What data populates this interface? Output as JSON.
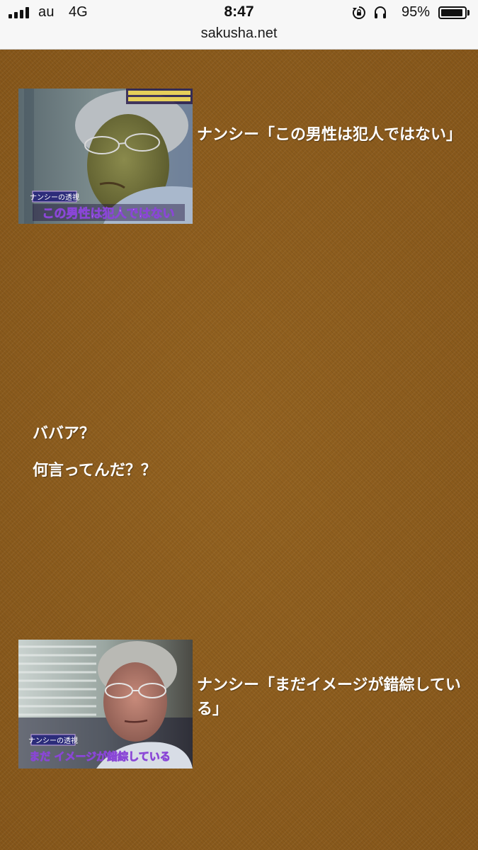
{
  "status_bar": {
    "carrier": "au",
    "network": "4G",
    "time": "8:47",
    "battery_percent": "95%",
    "battery_level": 0.95,
    "icons": [
      "signal-icon",
      "rotation-lock-icon",
      "headphone-icon",
      "battery-icon"
    ]
  },
  "browser": {
    "url": "sakusha.net"
  },
  "article": {
    "items": [
      {
        "image_subtitle": "この男性は犯人ではない",
        "image_label": "ナンシーの透視",
        "caption": "ナンシー「この男性は犯人ではない」"
      },
      {
        "image_subtitle": "まだ イメージが錯綜している",
        "image_label": "ナンシーの透視",
        "caption": "ナンシー「まだイメージが錯綜している」"
      }
    ],
    "remarks": [
      "ババア？",
      "何言ってんだ？？"
    ]
  },
  "colors": {
    "page_background": "#8a5a1c",
    "text": "#ffffff",
    "status_bar_background": "#f7f7f7"
  }
}
